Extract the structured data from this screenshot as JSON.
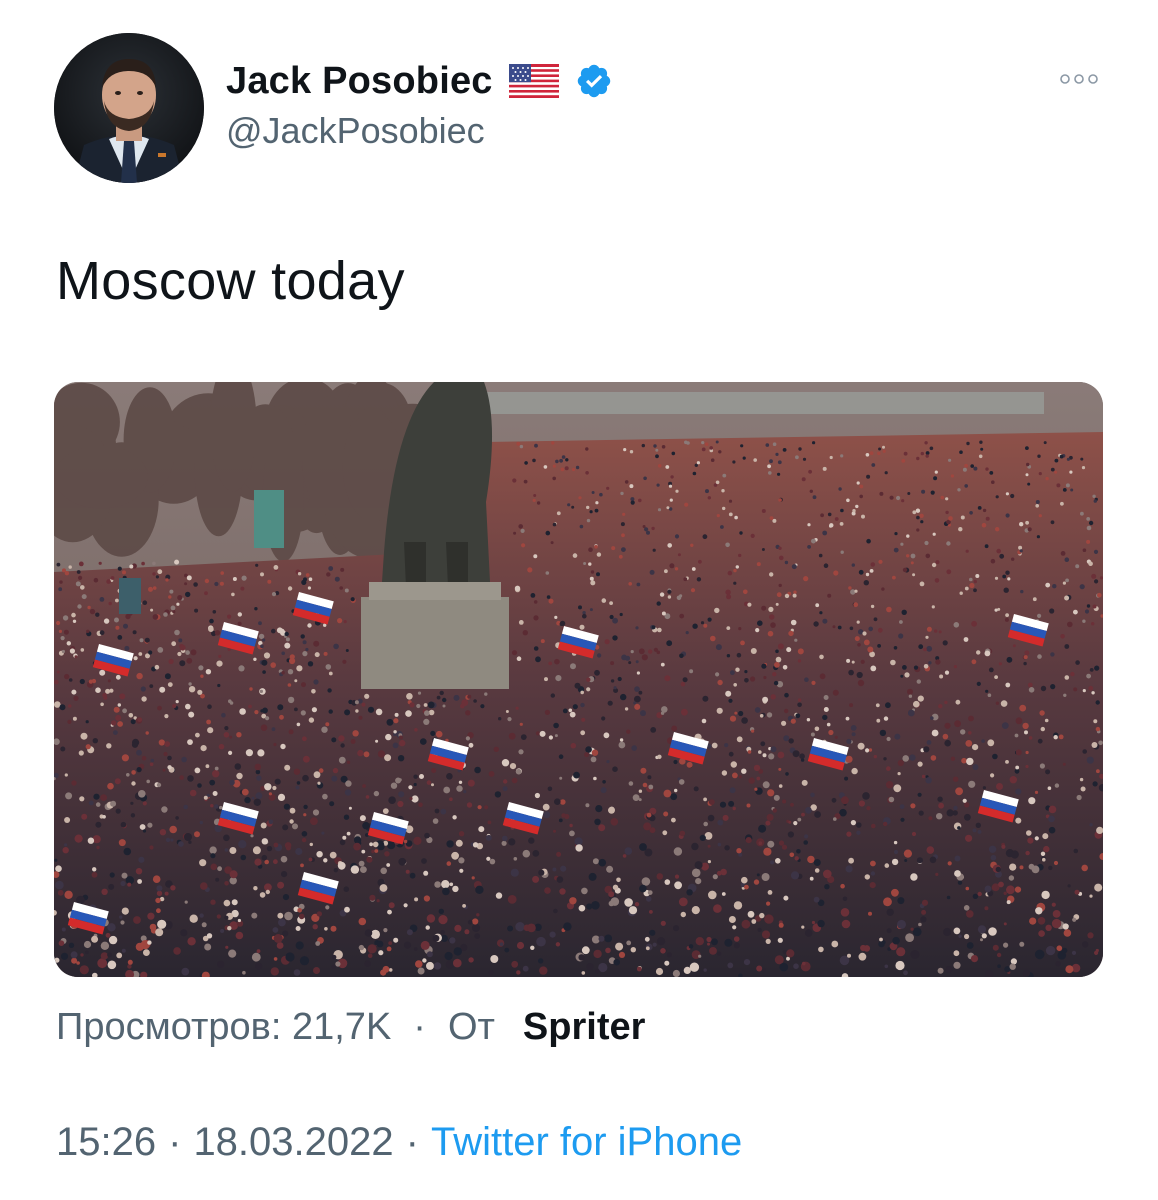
{
  "author": {
    "display_name": "Jack Posobiec",
    "handle": "@JackPosobiec",
    "flag_icon": "us-flag-icon",
    "verified_icon": "verified-badge-icon",
    "verified_color": "#1d9bf0"
  },
  "more_icon": "more-options-icon",
  "tweet": {
    "text": "Moscow today"
  },
  "media": {
    "kind": "photo",
    "subject": "crowd-with-flags-and-statue"
  },
  "meta": {
    "views_label": "Просмотров: 21,7K",
    "separator": "·",
    "from_label": "От",
    "source_name": "Spriter"
  },
  "timestamp": {
    "time": "15:26",
    "separator": "·",
    "date": "18.03.2022",
    "separator2": "·",
    "client": "Twitter for iPhone"
  },
  "colors": {
    "text_primary": "#0f1419",
    "text_secondary": "#536471",
    "link": "#1d9bf0"
  }
}
